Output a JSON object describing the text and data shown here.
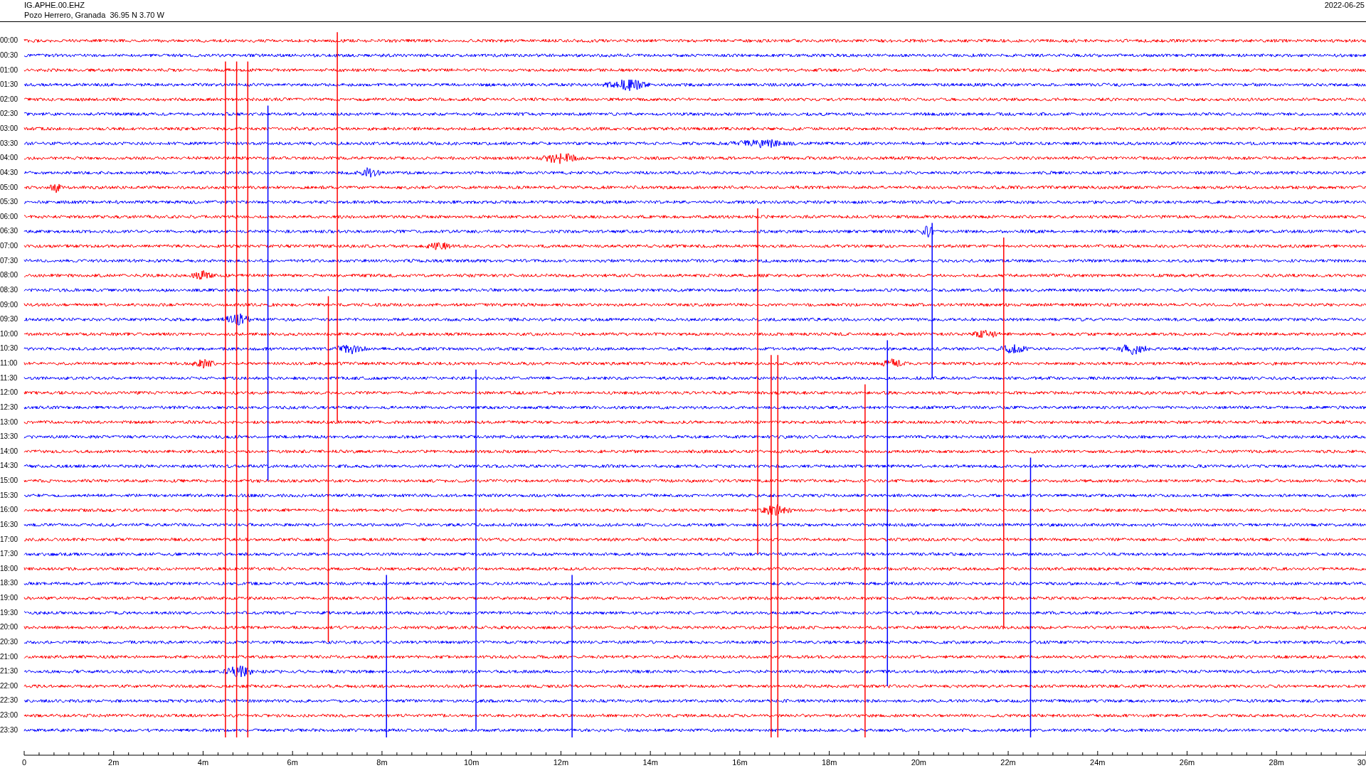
{
  "header": {
    "station": "IG.APHE.00.EHZ",
    "location": "Pozo Herrero, Granada  36.95 N 3.70 W",
    "date": "2022-06-25"
  },
  "rows": [
    {
      "label": "00:00",
      "color": "#ff0000"
    },
    {
      "label": "00:30",
      "color": "#0000ff"
    },
    {
      "label": "01:00",
      "color": "#ff0000"
    },
    {
      "label": "01:30",
      "color": "#0000ff"
    },
    {
      "label": "02:00",
      "color": "#ff0000"
    },
    {
      "label": "02:30",
      "color": "#0000ff"
    },
    {
      "label": "03:00",
      "color": "#ff0000"
    },
    {
      "label": "03:30",
      "color": "#0000ff"
    },
    {
      "label": "04:00",
      "color": "#ff0000"
    },
    {
      "label": "04:30",
      "color": "#0000ff"
    },
    {
      "label": "05:00",
      "color": "#ff0000"
    },
    {
      "label": "05:30",
      "color": "#0000ff"
    },
    {
      "label": "06:00",
      "color": "#ff0000"
    },
    {
      "label": "06:30",
      "color": "#0000ff"
    },
    {
      "label": "07:00",
      "color": "#ff0000"
    },
    {
      "label": "07:30",
      "color": "#0000ff"
    },
    {
      "label": "08:00",
      "color": "#ff0000"
    },
    {
      "label": "08:30",
      "color": "#0000ff"
    },
    {
      "label": "09:00",
      "color": "#ff0000"
    },
    {
      "label": "09:30",
      "color": "#0000ff"
    },
    {
      "label": "10:00",
      "color": "#ff0000"
    },
    {
      "label": "10:30",
      "color": "#0000ff"
    },
    {
      "label": "11:00",
      "color": "#ff0000"
    },
    {
      "label": "11:30",
      "color": "#0000ff"
    },
    {
      "label": "12:00",
      "color": "#ff0000"
    },
    {
      "label": "12:30",
      "color": "#0000ff"
    },
    {
      "label": "13:00",
      "color": "#ff0000"
    },
    {
      "label": "13:30",
      "color": "#0000ff"
    },
    {
      "label": "14:00",
      "color": "#ff0000"
    },
    {
      "label": "14:30",
      "color": "#0000ff"
    },
    {
      "label": "15:00",
      "color": "#ff0000"
    },
    {
      "label": "15:30",
      "color": "#0000ff"
    },
    {
      "label": "16:00",
      "color": "#ff0000"
    },
    {
      "label": "16:30",
      "color": "#0000ff"
    },
    {
      "label": "17:00",
      "color": "#ff0000"
    },
    {
      "label": "17:30",
      "color": "#0000ff"
    },
    {
      "label": "18:00",
      "color": "#ff0000"
    },
    {
      "label": "18:30",
      "color": "#0000ff"
    },
    {
      "label": "19:00",
      "color": "#ff0000"
    },
    {
      "label": "19:30",
      "color": "#0000ff"
    },
    {
      "label": "20:00",
      "color": "#ff0000"
    },
    {
      "label": "20:30",
      "color": "#0000ff"
    },
    {
      "label": "21:00",
      "color": "#ff0000"
    },
    {
      "label": "21:30",
      "color": "#0000ff"
    },
    {
      "label": "22:00",
      "color": "#ff0000"
    },
    {
      "label": "22:30",
      "color": "#0000ff"
    },
    {
      "label": "23:00",
      "color": "#ff0000"
    },
    {
      "label": "23:30",
      "color": "#0000ff"
    }
  ],
  "x_axis": {
    "tick_labels": [
      "0",
      "2m",
      "4m",
      "6m",
      "8m",
      "10m",
      "12m",
      "14m",
      "16m",
      "18m",
      "20m",
      "22m",
      "24m",
      "26m",
      "28m",
      "30"
    ]
  }
}
